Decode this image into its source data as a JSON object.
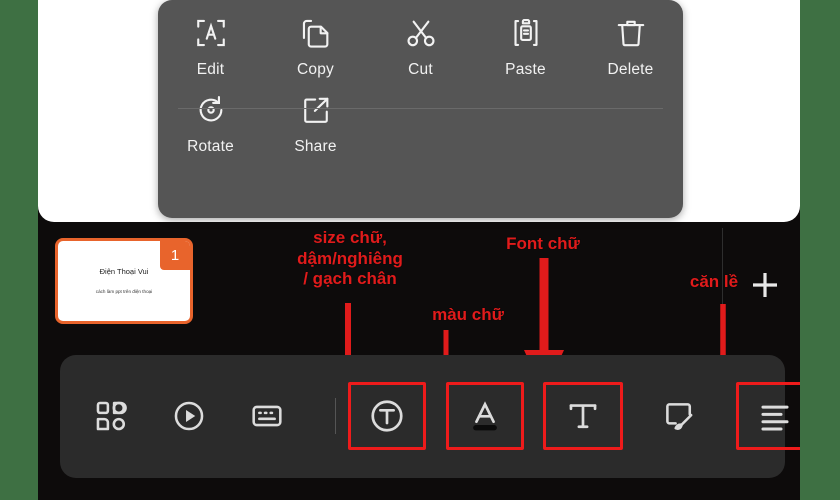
{
  "app": {
    "frame_color": "#3e7043",
    "screen_bg": "#0d0b0b",
    "accent_red": "#ee1b1b",
    "slide_accent": "#e8642c"
  },
  "context_menu": {
    "background": "#555555",
    "row1": [
      {
        "label": "Edit",
        "icon": "edit-letter-a-icon"
      },
      {
        "label": "Copy",
        "icon": "copy-icon"
      },
      {
        "label": "Cut",
        "icon": "scissors-icon"
      },
      {
        "label": "Paste",
        "icon": "clipboard-paste-icon"
      },
      {
        "label": "Delete",
        "icon": "trash-icon"
      }
    ],
    "row2": [
      {
        "label": "Rotate",
        "icon": "rotate-icon"
      },
      {
        "label": "Share",
        "icon": "share-icon"
      }
    ]
  },
  "slide_thumbnail": {
    "number": "1",
    "title": "Điện Thoại Vui",
    "subtitle": "cách làm ppt trên điện thoại"
  },
  "annotations": [
    {
      "id": "lab1",
      "text": "size chữ,\ndậm/nghiêng\n/ gạch chân",
      "color": "#e01b1b"
    },
    {
      "id": "lab2",
      "text": "màu chữ",
      "color": "#e01b1b"
    },
    {
      "id": "lab3",
      "text": "Font chữ",
      "color": "#e01b1b"
    },
    {
      "id": "lab4",
      "text": "căn lề",
      "color": "#e01b1b"
    }
  ],
  "annotation_lines": {
    "line1": "size chữ,",
    "line2": "dậm/nghiêng",
    "line3": "/ gạch chân",
    "mau_chu": "màu chữ",
    "font_chu": "Font chữ",
    "can_le": "căn lề"
  },
  "toolbar": {
    "background": "#2b2b2b",
    "items": [
      {
        "name": "shapes-grid-icon",
        "highlighted": false
      },
      {
        "name": "play-circle-icon",
        "highlighted": false
      },
      {
        "name": "caption-box-icon",
        "highlighted": false
      },
      {
        "name": "text-format-circle-t-icon",
        "highlighted": true
      },
      {
        "name": "text-color-a-icon",
        "highlighted": true
      },
      {
        "name": "font-serif-t-icon",
        "highlighted": true
      },
      {
        "name": "shape-brush-icon",
        "highlighted": false
      },
      {
        "name": "align-left-icon",
        "highlighted": true
      }
    ]
  }
}
